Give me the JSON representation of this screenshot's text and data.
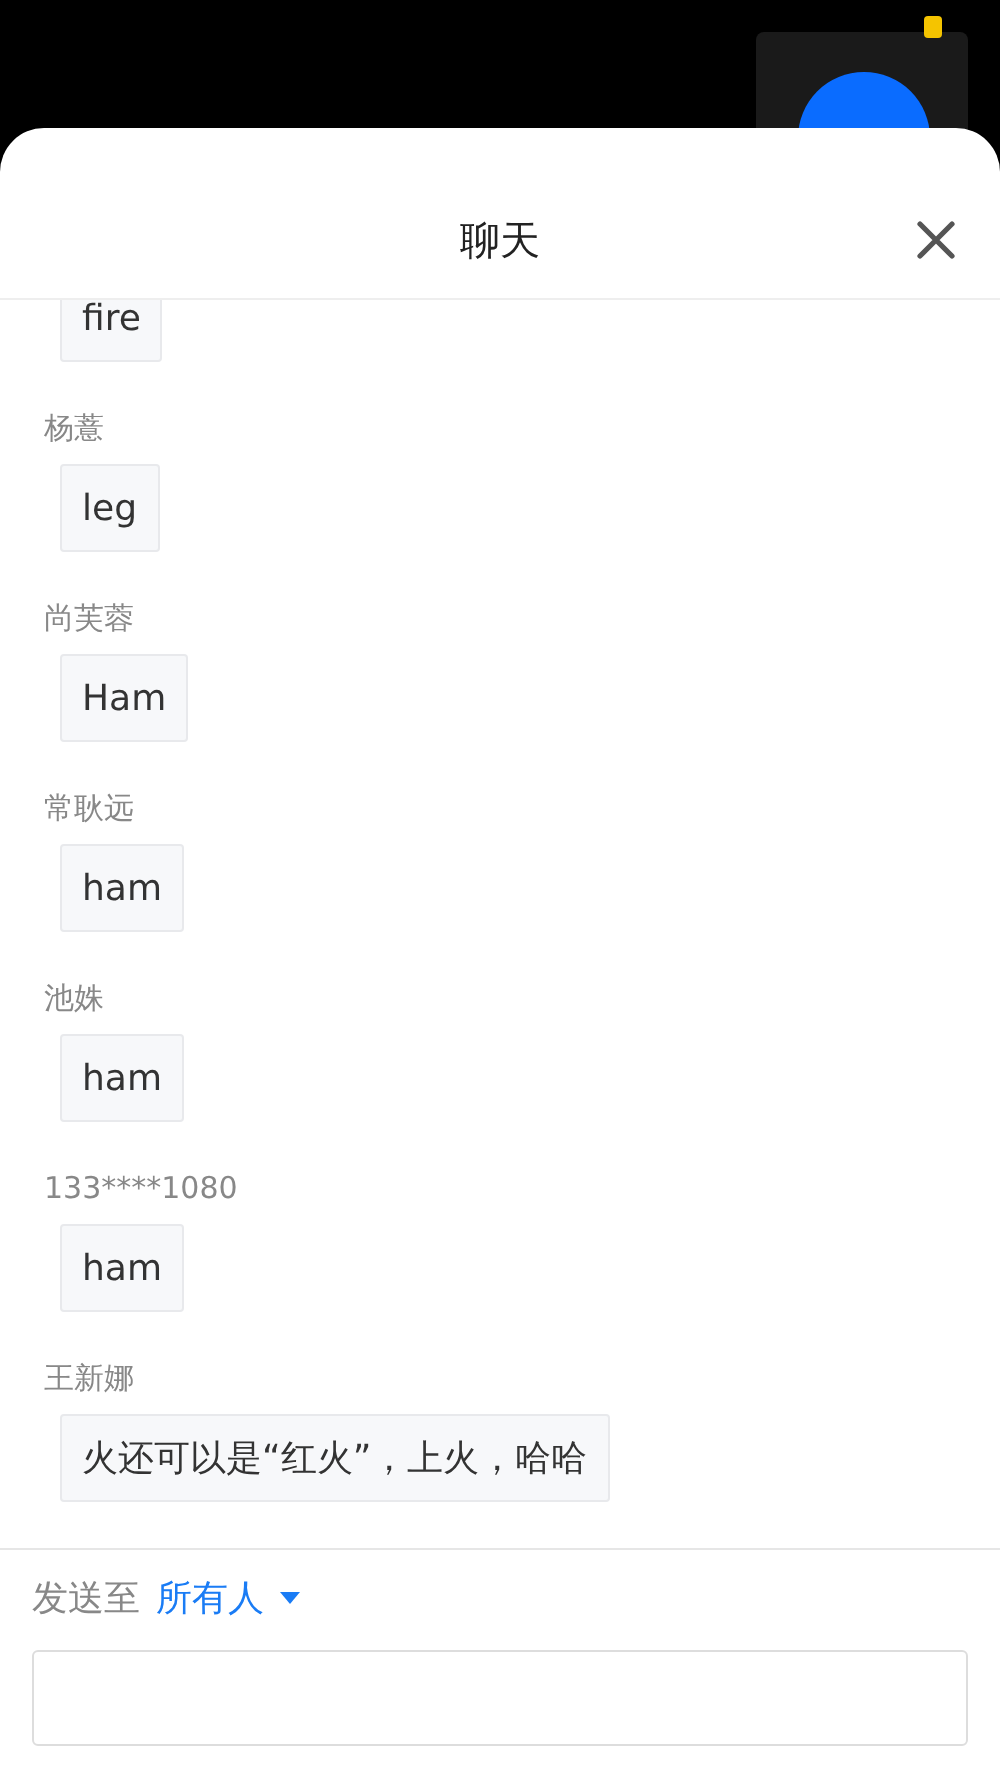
{
  "dialog": {
    "title": "聊天"
  },
  "messages": [
    {
      "text": "fire"
    },
    {
      "sender": "杨薏",
      "text": "leg"
    },
    {
      "sender": "尚芙蓉",
      "text": "Ham"
    },
    {
      "sender": "常耿远",
      "text": "ham"
    },
    {
      "sender": "池姝",
      "text": "ham"
    },
    {
      "sender": "133****1080",
      "text": "ham"
    },
    {
      "sender": "王新娜",
      "text": "火还可以是“红火”，上火，哈哈"
    }
  ],
  "composer": {
    "send_to_label": "发送至",
    "recipient": "所有人"
  }
}
